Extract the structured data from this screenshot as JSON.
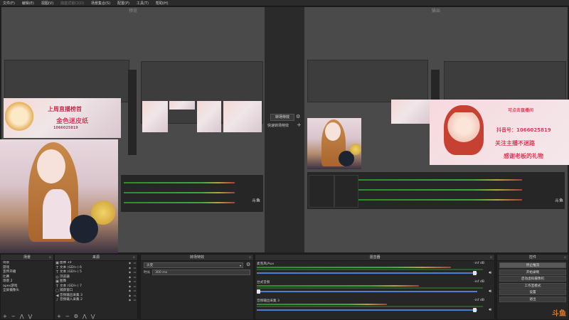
{
  "menu": [
    "文件(F)",
    "编辑(E)",
    "视图(V)",
    "底座式窗口(D)",
    "场景集合(S)",
    "配置(P)",
    "工具(T)",
    "帮助(H)"
  ],
  "preview_label": "预览",
  "program_label": "输出",
  "overlay_banner": "上周直播榜首",
  "overlay_sub": "金色迷皮纸",
  "overlay_id": "1066025819",
  "program_overlay": {
    "line1": "抖音号：1066025819",
    "line2": "关注主播不迷路",
    "line3": "感谢老板的礼物",
    "line4": "可点击直播间"
  },
  "watermark_small": "斗鱼",
  "transition_mid": {
    "button": "转场特效",
    "label": "快速转场特效"
  },
  "docks": {
    "scenes": {
      "title": "场景",
      "items": [
        "场景",
        "游戏",
        "宣传开播",
        "比赛",
        "场景 2",
        "apex游戏",
        "全屏摄像头"
      ]
    },
    "sources": {
      "title": "来源",
      "items": [
        {
          "icon": "image-icon",
          "label": "图像 10"
        },
        {
          "icon": "text-icon",
          "label": "文本 (GDI+) 6"
        },
        {
          "icon": "text-icon",
          "label": "文本 (GDI+) 5"
        },
        {
          "icon": "browser-icon",
          "label": "浏览器"
        },
        {
          "icon": "image-icon",
          "label": "图像"
        },
        {
          "icon": "text-icon",
          "label": "文本 (GDI+) 7"
        },
        {
          "icon": "window-icon",
          "label": "捕获窗口"
        },
        {
          "icon": "speaker-icon",
          "label": "音频输出采集 3"
        },
        {
          "icon": "mic-icon",
          "label": "音频输入采集 2"
        }
      ]
    },
    "transitions": {
      "title": "转场特效",
      "type": "淡变",
      "duration_label": "时长",
      "duration_value": "300 ms"
    },
    "mixer": {
      "title": "混音器",
      "channels": [
        {
          "name": "麦克风/Aux",
          "db": "-inf dB",
          "level": 0.85
        },
        {
          "name": "台式音频",
          "db": "-inf dB",
          "level": 0.7
        },
        {
          "name": "音频输出采集 3",
          "db": "-inf dB",
          "level": 0.55
        }
      ]
    },
    "controls": {
      "title": "控件",
      "buttons": [
        "停止推流",
        "开始录制",
        "启动虚拟摄像机",
        "工作室模式",
        "设置",
        "退出"
      ]
    }
  },
  "watermark": "斗鱼",
  "colors": {
    "accent": "#4b7fd1",
    "banner": "#d23a5a",
    "brand": "#e07a2a"
  }
}
